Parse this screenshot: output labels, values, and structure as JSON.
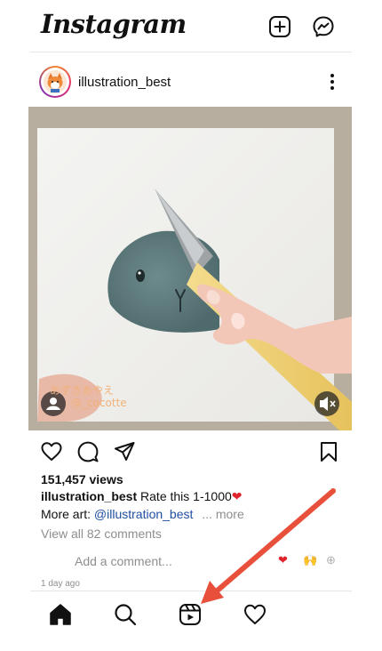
{
  "app": {
    "logo": "Instagram"
  },
  "post": {
    "username": "illustration_best",
    "views": "151,457 views",
    "caption_user": "illustration_best",
    "caption_text": "Rate this 1-1000",
    "caption_emoji": "❤",
    "more_art_label": "More art:",
    "more_art_handle": "@illustration_best",
    "more_label": "... more",
    "view_comments": "View all 82 comments",
    "add_comment_placeholder": "Add a comment...",
    "reaction_heart": "❤",
    "reaction_hands": "🙌",
    "reaction_add": "⊕",
    "time_ago": "1 day ago",
    "media_watermark_line1": "あずきあやえ",
    "media_watermark_line2": "@_cocotte"
  },
  "icons": {
    "new_post": "plus-square-icon",
    "messenger": "messenger-icon",
    "like": "heart-icon",
    "comment": "comment-icon",
    "share": "paper-plane-icon",
    "save": "bookmark-icon",
    "home": "home-icon",
    "search": "search-icon",
    "reels": "reels-icon",
    "activity": "heart-icon"
  },
  "colors": {
    "link": "#1f4ea2",
    "annotation_arrow": "#e8503c",
    "heart": "#e0242e"
  }
}
